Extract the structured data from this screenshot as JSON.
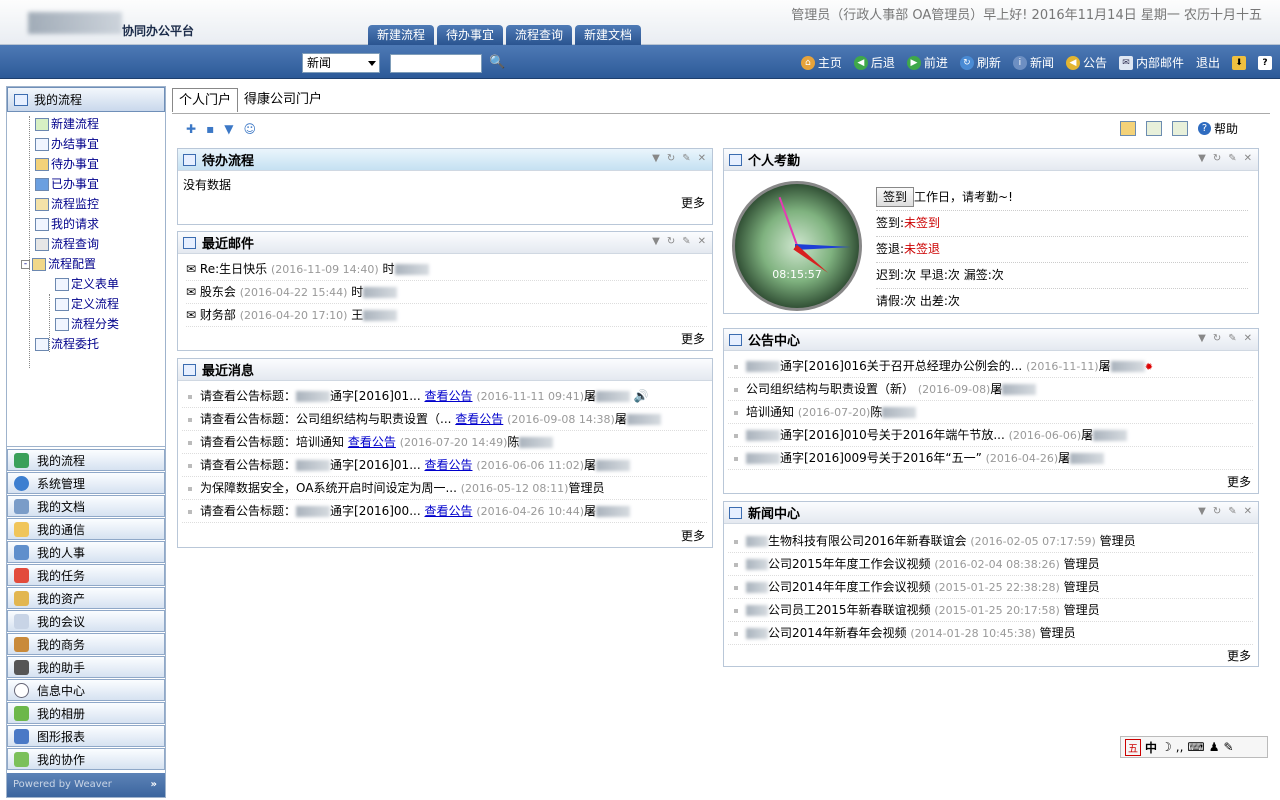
{
  "header": {
    "app_title": "协同办公平台",
    "greeting": "管理员（行政人事部  OA管理员）早上好!   2016年11月14日  星期一  农历十月十五",
    "tabs": [
      "新建流程",
      "待办事宜",
      "流程查询",
      "新建文档"
    ]
  },
  "toolbar": {
    "search_select": "新闻",
    "search_input": "",
    "items": [
      "主页",
      "后退",
      "前进",
      "刷新",
      "新闻",
      "公告",
      "内部邮件",
      "退出"
    ]
  },
  "sidebar": {
    "header": "我的流程",
    "tree": [
      {
        "label": "新建流程",
        "level": 1
      },
      {
        "label": "办结事宜",
        "level": 1
      },
      {
        "label": "待办事宜",
        "level": 1
      },
      {
        "label": "已办事宜",
        "level": 1
      },
      {
        "label": "流程监控",
        "level": 1
      },
      {
        "label": "我的请求",
        "level": 1
      },
      {
        "label": "流程查询",
        "level": 1
      },
      {
        "label": "流程配置",
        "level": 1
      },
      {
        "label": "定义表单",
        "level": 2
      },
      {
        "label": "定义流程",
        "level": 2
      },
      {
        "label": "流程分类",
        "level": 2
      },
      {
        "label": "流程委托",
        "level": 1
      }
    ],
    "menu": [
      "我的流程",
      "系统管理",
      "我的文档",
      "我的通信",
      "我的人事",
      "我的任务",
      "我的资产",
      "我的会议",
      "我的商务",
      "我的助手",
      "信息中心",
      "我的相册",
      "图形报表",
      "我的协作"
    ],
    "powered": "Powered by Weaver"
  },
  "main": {
    "tabs": [
      "个人门户",
      "得康公司门户"
    ],
    "help": "帮助",
    "more": "更多"
  },
  "todo": {
    "title": "待办流程",
    "empty": "没有数据"
  },
  "mail": {
    "title": "最近邮件",
    "items": [
      {
        "subject": "Re:生日快乐",
        "date": "(2016-11-09 14:40)",
        "from": "时"
      },
      {
        "subject": "股东会",
        "date": "(2016-04-22 15:44)",
        "from": "时"
      },
      {
        "subject": "财务部",
        "date": "(2016-04-20 17:10)",
        "from": "王"
      }
    ]
  },
  "messages": {
    "title": "最近消息",
    "link": "查看公告",
    "items": [
      {
        "text": "请查看公告标题：",
        "subject": "通字[2016]01...",
        "date": "(2016-11-11 09:41)",
        "from": "屠"
      },
      {
        "text": "请查看公告标题：",
        "subject": "公司组织结构与职责设置（...",
        "date": "(2016-09-08 14:38)",
        "from": "屠"
      },
      {
        "text": "请查看公告标题：",
        "subject": "培训通知",
        "date": "(2016-07-20 14:49)",
        "from": "陈"
      },
      {
        "text": "请查看公告标题：",
        "subject": "通字[2016]01...",
        "date": "(2016-06-06 11:02)",
        "from": "屠"
      },
      {
        "text": "为保障数据安全，OA系统开启时间设定为周一...",
        "subject": "",
        "date": "(2016-05-12 08:11)",
        "from": "管理员"
      },
      {
        "text": "请查看公告标题：",
        "subject": "通字[2016]00...",
        "date": "(2016-04-26 10:44)",
        "from": "屠"
      }
    ]
  },
  "attendance": {
    "title": "个人考勤",
    "clock_time": "08:15:57",
    "signin_button": "签到",
    "workday_text": "工作日，请考勤~!",
    "signin_label": "签到:",
    "signin_status": "未签到",
    "signout_label": "签退:",
    "signout_status": "未签退",
    "late": "迟到:次   早退:次   漏签:次",
    "leave": "请假:次   出差:次"
  },
  "notices": {
    "title": "公告中心",
    "items": [
      {
        "subject": "通字[2016]016关于召开总经理办公例会的...",
        "date": "(2016-11-11)",
        "from": "屠",
        "new": true
      },
      {
        "subject": "公司组织结构与职责设置（新）",
        "date": "(2016-09-08)",
        "from": "屠",
        "new": false
      },
      {
        "subject": "培训通知",
        "date": "(2016-07-20)",
        "from": "陈",
        "new": false
      },
      {
        "subject": "通字[2016]010号关于2016年端午节放...",
        "date": "(2016-06-06)",
        "from": "屠",
        "new": false
      },
      {
        "subject": "通字[2016]009号关于2016年“五一”",
        "date": "(2016-04-26)",
        "from": "屠",
        "new": false
      }
    ]
  },
  "news": {
    "title": "新闻中心",
    "items": [
      {
        "subject": "生物科技有限公司2016年新春联谊会",
        "date": "(2016-02-05 07:17:59)",
        "from": "管理员"
      },
      {
        "subject": "公司2015年年度工作会议视频",
        "date": "(2016-02-04 08:38:26)",
        "from": "管理员"
      },
      {
        "subject": "公司2014年年度工作会议视频",
        "date": "(2015-01-25 22:38:28)",
        "from": "管理员"
      },
      {
        "subject": "公司员工2015年新春联谊视频",
        "date": "(2015-01-25 20:17:58)",
        "from": "管理员"
      },
      {
        "subject": "公司2014年新春年会视频",
        "date": "(2014-01-28 10:45:38)",
        "from": "管理员"
      }
    ]
  },
  "ime": {
    "label": "五 中"
  }
}
